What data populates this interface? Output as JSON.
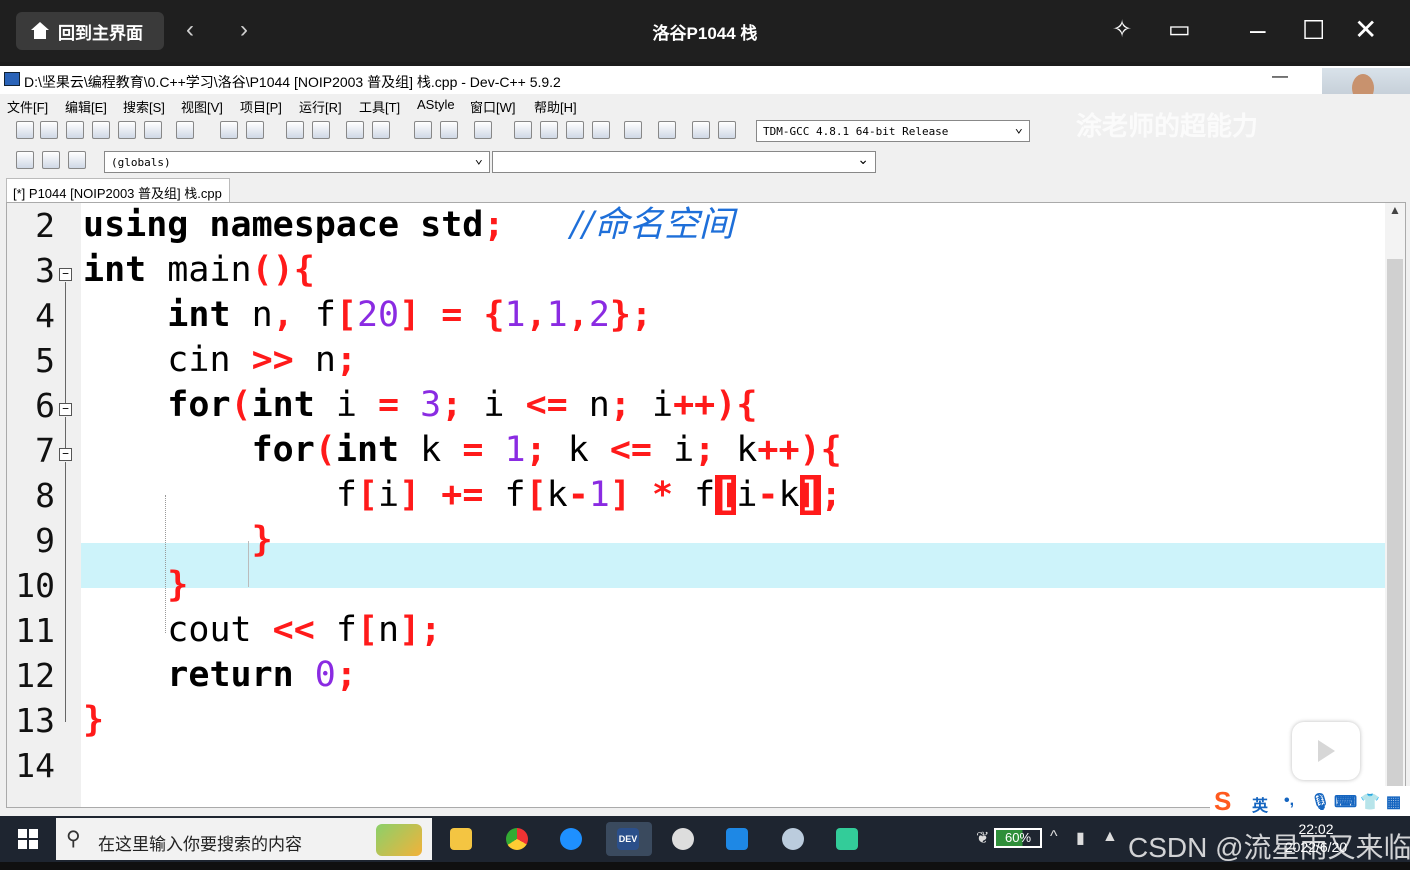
{
  "player": {
    "home_label": "回到主界面",
    "back_icon": "‹",
    "forward_icon": "›",
    "title": "洛谷P1044 栈"
  },
  "ide": {
    "window_title": "D:\\坚果云\\编程教育\\0.C++学习\\洛谷\\P1044 [NOIP2003 普及组] 栈.cpp - Dev-C++ 5.9.2",
    "menu": [
      "文件[F]",
      "编辑[E]",
      "搜索[S]",
      "视图[V]",
      "项目[P]",
      "运行[R]",
      "工具[T]",
      "AStyle",
      "窗口[W]",
      "帮助[H]"
    ],
    "compiler": "TDM-GCC 4.8.1 64-bit Release",
    "scope": "(globals)",
    "tab": "[*] P1044 [NOIP2003 普及组] 栈.cpp",
    "brand_watermark": "涂老师的超能力",
    "highlight_line": 8
  },
  "code": {
    "line_numbers": [
      "2",
      "3",
      "4",
      "5",
      "6",
      "7",
      "8",
      "9",
      "10",
      "11",
      "12",
      "13",
      "14"
    ],
    "l2": {
      "a": "using namespace std",
      "b": ";",
      "c": "//命名空间"
    },
    "l3": {
      "a": "int",
      "b": " main",
      "c": "(){"
    },
    "l4": {
      "a": "int",
      "b": " n",
      "c": ",",
      "d": " f",
      "e": "[",
      "f": "20",
      "g": "]",
      "h": " = ",
      "i": "{",
      "j": "1",
      "k": ",",
      "l": "1",
      "m": ",",
      "n": "2",
      "o": "};"
    },
    "l5": {
      "a": "cin",
      "b": " >> ",
      "c": "n",
      "d": ";"
    },
    "l6": {
      "a": "for",
      "b": "(",
      "c": "int",
      "d": " i ",
      "e": "=",
      "f": " 3",
      "g": ";",
      "h": " i ",
      "i": "<=",
      "j": " n",
      "k": ";",
      "l": " i",
      "m": "++){"
    },
    "l7": {
      "a": "for",
      "b": "(",
      "c": "int",
      "d": " k ",
      "e": "=",
      "f": " 1",
      "g": ";",
      "h": " k ",
      "i": "<=",
      "j": " i",
      "k": ";",
      "l": " k",
      "m": "++){"
    },
    "l8": {
      "a": "f",
      "b": "[",
      "c": "i",
      "d": "]",
      "e": " += ",
      "f": "f",
      "g": "[",
      "h": "k",
      "i": "-",
      "j": "1",
      "k": "]",
      "l": " * ",
      "m": "f",
      "n": "[",
      "o": "i",
      "p": "-",
      "q": "k",
      "r": "]",
      "s": ";"
    },
    "l9": "}",
    "l10": "}",
    "l11": {
      "a": "cout",
      "b": " << ",
      "c": "f",
      "d": "[",
      "e": "n",
      "f": "];"
    },
    "l12": {
      "a": "return",
      "b": " 0",
      "c": ";"
    },
    "l13": "}"
  },
  "ime": {
    "lang": "英",
    "punct": "•,",
    "icons": [
      "mic-icon",
      "keyboard-icon",
      "skin-icon",
      "grid-icon"
    ]
  },
  "taskbar": {
    "search_placeholder": "在这里输入你要搜索的内容",
    "battery": "60%",
    "time": "22:02",
    "date": "2022/6/20",
    "dev_label": "DEV"
  },
  "watermark": "CSDN @流星雨又来临"
}
